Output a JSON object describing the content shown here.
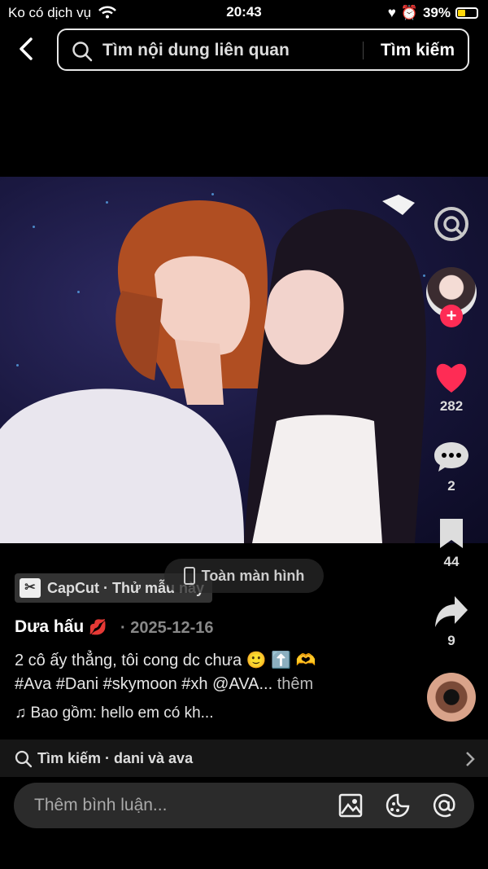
{
  "status": {
    "carrier": "Ko có dịch vụ",
    "time": "20:43",
    "battery": "39%",
    "battery_level": 0.39
  },
  "header": {
    "search_placeholder": "Tìm nội dung liên quan",
    "search_button": "Tìm kiếm"
  },
  "video": {
    "fullscreen_label": "Toàn màn hình"
  },
  "sidebar": {
    "likes": "282",
    "comments": "2",
    "bookmarks": "44",
    "shares": "9"
  },
  "post": {
    "capcut_label": "CapCut · Thử mẫu này",
    "author": "Dưa hấu",
    "date": "· 2025-12-16",
    "caption_line1": "2 cô ấy thẳng, tôi cong dc chưa 🙂 ⬆️ 🫶",
    "caption_line2": "#Ava #Dani #skymoon #xh @AVA...",
    "more": "thêm",
    "music": "Bao gồm: hello em có kh..."
  },
  "related": {
    "label": "Tìm kiếm · dani và ava"
  },
  "comment_bar": {
    "placeholder": "Thêm bình luận..."
  },
  "colors": {
    "like": "#fe2c55",
    "battery": "#ffd60a",
    "background": "#000000"
  }
}
